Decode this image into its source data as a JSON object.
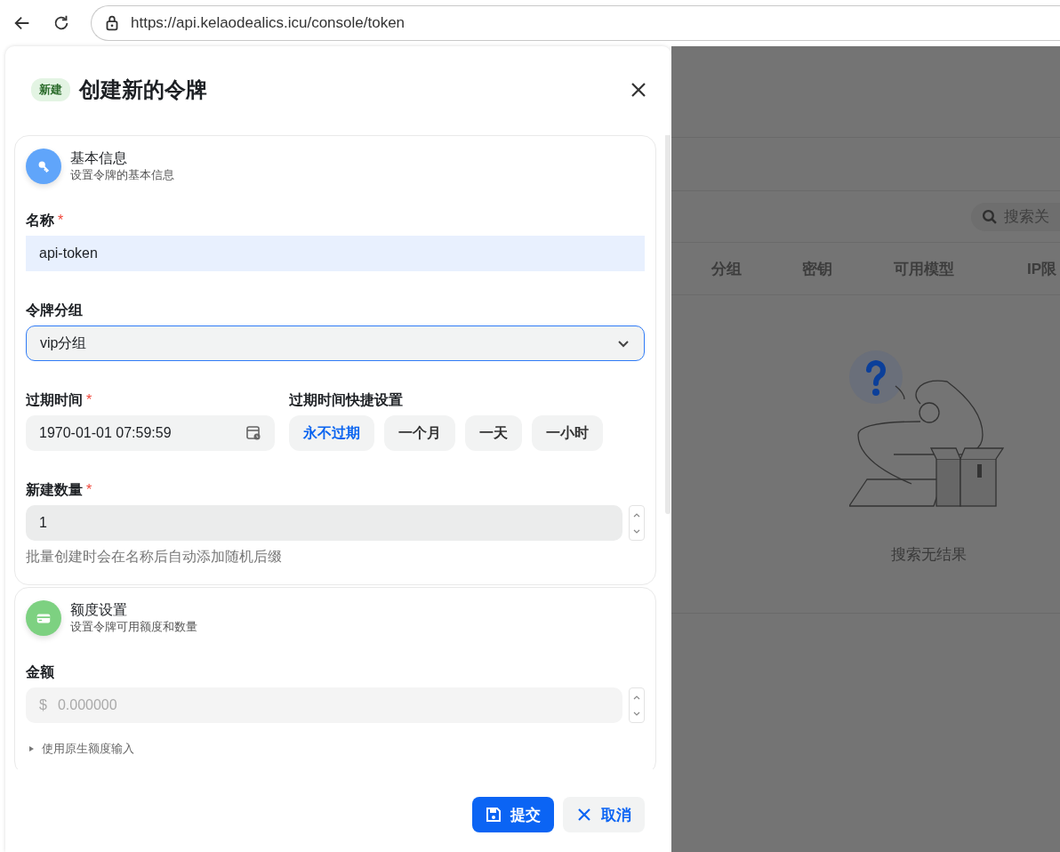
{
  "browser": {
    "url": "https://api.kelaodealics.icu/console/token"
  },
  "sheet": {
    "badge": "新建",
    "title": "创建新的令牌",
    "sections": [
      {
        "kind": "key",
        "color": "#60a5fa",
        "title": "基本信息",
        "subtitle": "设置令牌的基本信息",
        "fields": [
          {
            "kind": "text",
            "label": "名称",
            "required_mark": "*",
            "value": "api-token"
          },
          {
            "kind": "select",
            "label": "令牌分组",
            "value": "vip分组",
            "focused": true
          },
          {
            "kind": "date",
            "label": "过期时间",
            "required_mark": "*",
            "value": "1970-01-01 07:59:59",
            "quick_label": "过期时间快捷设置",
            "quick_options": [
              {
                "label": "永不过期",
                "selected": true
              },
              {
                "label": "一个月",
                "selected": false
              },
              {
                "label": "一天",
                "selected": false
              },
              {
                "label": "一小时",
                "selected": false
              }
            ]
          },
          {
            "kind": "number",
            "label": "新建数量",
            "required_mark": "*",
            "value": "1",
            "help": "批量创建时会在名称后自动添加随机后缀"
          }
        ]
      },
      {
        "kind": "card",
        "color": "#7dd181",
        "title": "额度设置",
        "subtitle": "设置令牌可用额度和数量",
        "fields": [
          {
            "kind": "number",
            "label": "金额",
            "prefix": "$",
            "placeholder": "0.000000"
          },
          {
            "kind": "toggle",
            "label": "使用原生额度输入",
            "expanded": false
          }
        ]
      }
    ],
    "buttons": [
      {
        "kind": "primary",
        "label": "提交"
      },
      {
        "kind": "secondary",
        "label": "取消"
      }
    ]
  },
  "background": {
    "search": {
      "placeholder": "搜索关"
    },
    "columns": [
      "分组",
      "密钥",
      "可用模型",
      "IP限"
    ],
    "empty_text": "搜索无结果"
  }
}
